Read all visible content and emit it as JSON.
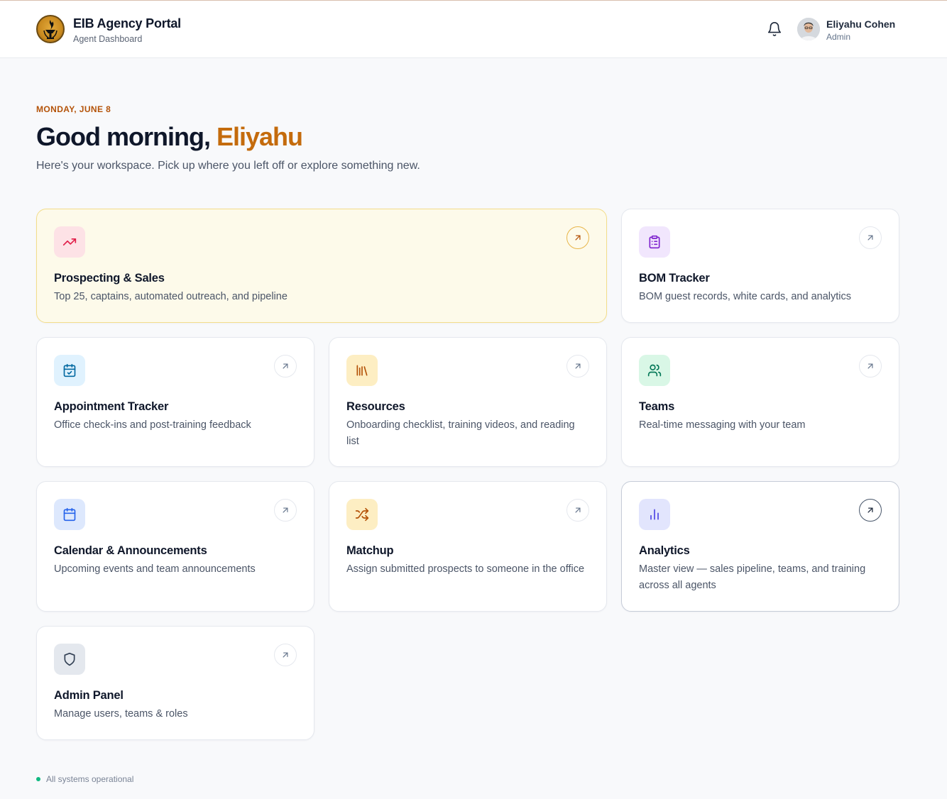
{
  "header": {
    "brand_title": "EIB Agency Portal",
    "brand_subtitle": "Agent Dashboard",
    "logo_icon": "torch-icon",
    "user": {
      "name": "Eliyahu Cohen",
      "role": "Admin"
    }
  },
  "hero": {
    "date": "MONDAY, JUNE 8",
    "greeting_prefix": "Good morning,",
    "greeting_name": "Eliyahu",
    "subtitle": "Here's your workspace. Pick up where you left off or explore something new."
  },
  "cards": [
    {
      "id": "prospecting",
      "title": "Prospecting & Sales",
      "description": "Top 25, captains, automated outreach, and pipeline",
      "icon": "trending-up-icon",
      "icon_bg": "#fde2e6",
      "icon_color": "#e11d48"
    },
    {
      "id": "bom",
      "title": "BOM Tracker",
      "description": "BOM guest records, white cards, and analytics",
      "icon": "clipboard-list-icon",
      "icon_bg": "#f1e6fd",
      "icon_color": "#7e22ce"
    },
    {
      "id": "appointment",
      "title": "Appointment Tracker",
      "description": "Office check-ins and post-training feedback",
      "icon": "calendar-check-icon",
      "icon_bg": "#e0f2fe",
      "icon_color": "#0369a1"
    },
    {
      "id": "resources",
      "title": "Resources",
      "description": "Onboarding checklist, training videos, and reading list",
      "icon": "library-icon",
      "icon_bg": "#fdeec3",
      "icon_color": "#b45309"
    },
    {
      "id": "teams",
      "title": "Teams",
      "description": "Real-time messaging with your team",
      "icon": "users-icon",
      "icon_bg": "#d9f7e6",
      "icon_color": "#047857"
    },
    {
      "id": "calendar",
      "title": "Calendar & Announcements",
      "description": "Upcoming events and team announcements",
      "icon": "calendar-icon",
      "icon_bg": "#dde8fd",
      "icon_color": "#2563eb"
    },
    {
      "id": "matchup",
      "title": "Matchup",
      "description": "Assign submitted prospects to someone in the office",
      "icon": "shuffle-icon",
      "icon_bg": "#fdeec3",
      "icon_color": "#b45309"
    },
    {
      "id": "analytics",
      "title": "Analytics",
      "description": "Master view — sales pipeline, teams, and training across all agents",
      "icon": "bar-chart-icon",
      "icon_bg": "#e2e5fd",
      "icon_color": "#4f46e5"
    },
    {
      "id": "admin",
      "title": "Admin Panel",
      "description": "Manage users, teams & roles",
      "icon": "shield-icon",
      "icon_bg": "#e4e8ee",
      "icon_color": "#334155"
    }
  ],
  "footer": {
    "status": "All systems operational"
  }
}
